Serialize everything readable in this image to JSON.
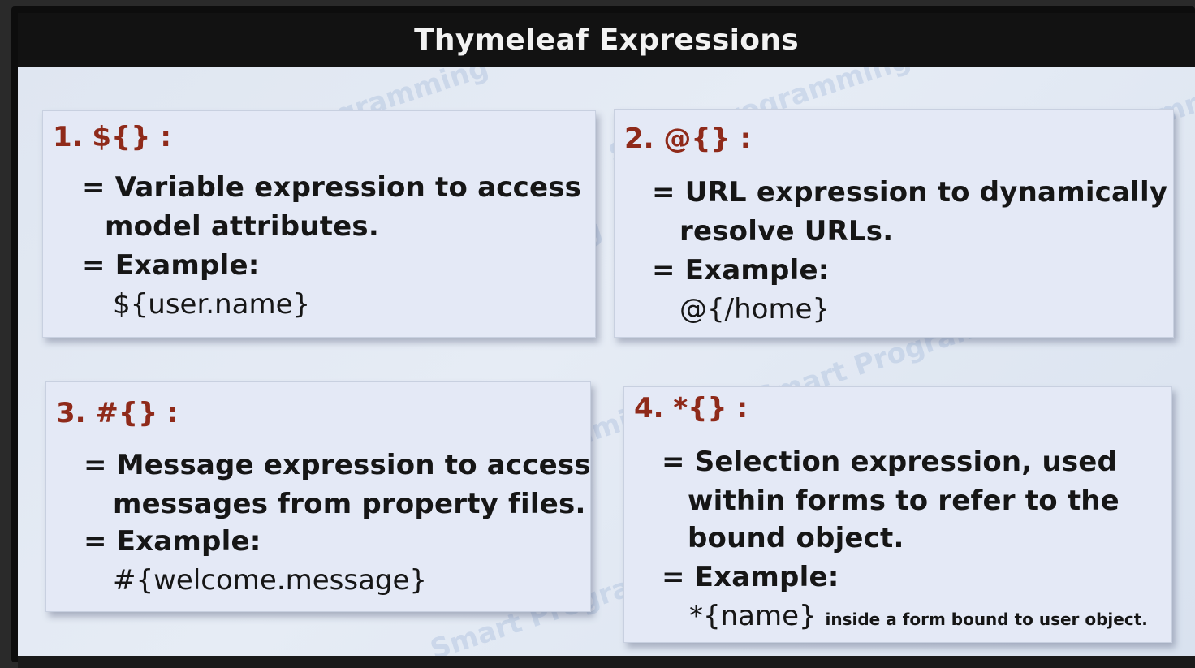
{
  "slide": {
    "title": "Thymeleaf Expressions",
    "watermark_text": "Smart Programming"
  },
  "cards": [
    {
      "heading": "1. ${} :",
      "description_line1": "= Variable expression to access",
      "description_line2": "model attributes.",
      "example_label": "= Example:",
      "example_code": "${user.name}"
    },
    {
      "heading": "2. @{} :",
      "description_line1": "= URL expression to dynamically",
      "description_line2": "resolve URLs.",
      "example_label": "= Example:",
      "example_code": "@{/home}"
    },
    {
      "heading": "3. #{} :",
      "description_line1": "= Message expression to access",
      "description_line2": "messages from property files.",
      "example_label": "= Example:",
      "example_code": "#{welcome.message}"
    },
    {
      "heading": "4. *{} :",
      "description_line1": "= Selection expression, used",
      "description_line2": "within forms to refer to the",
      "description_line3": "bound object.",
      "example_label": "= Example:",
      "example_code": "*{name}",
      "example_note": "inside a form bound to user object."
    }
  ],
  "colors": {
    "heading": "#8f2a1a",
    "body_text": "#161616",
    "card_background": "#e4e9f6",
    "title_bar": "#121212"
  }
}
